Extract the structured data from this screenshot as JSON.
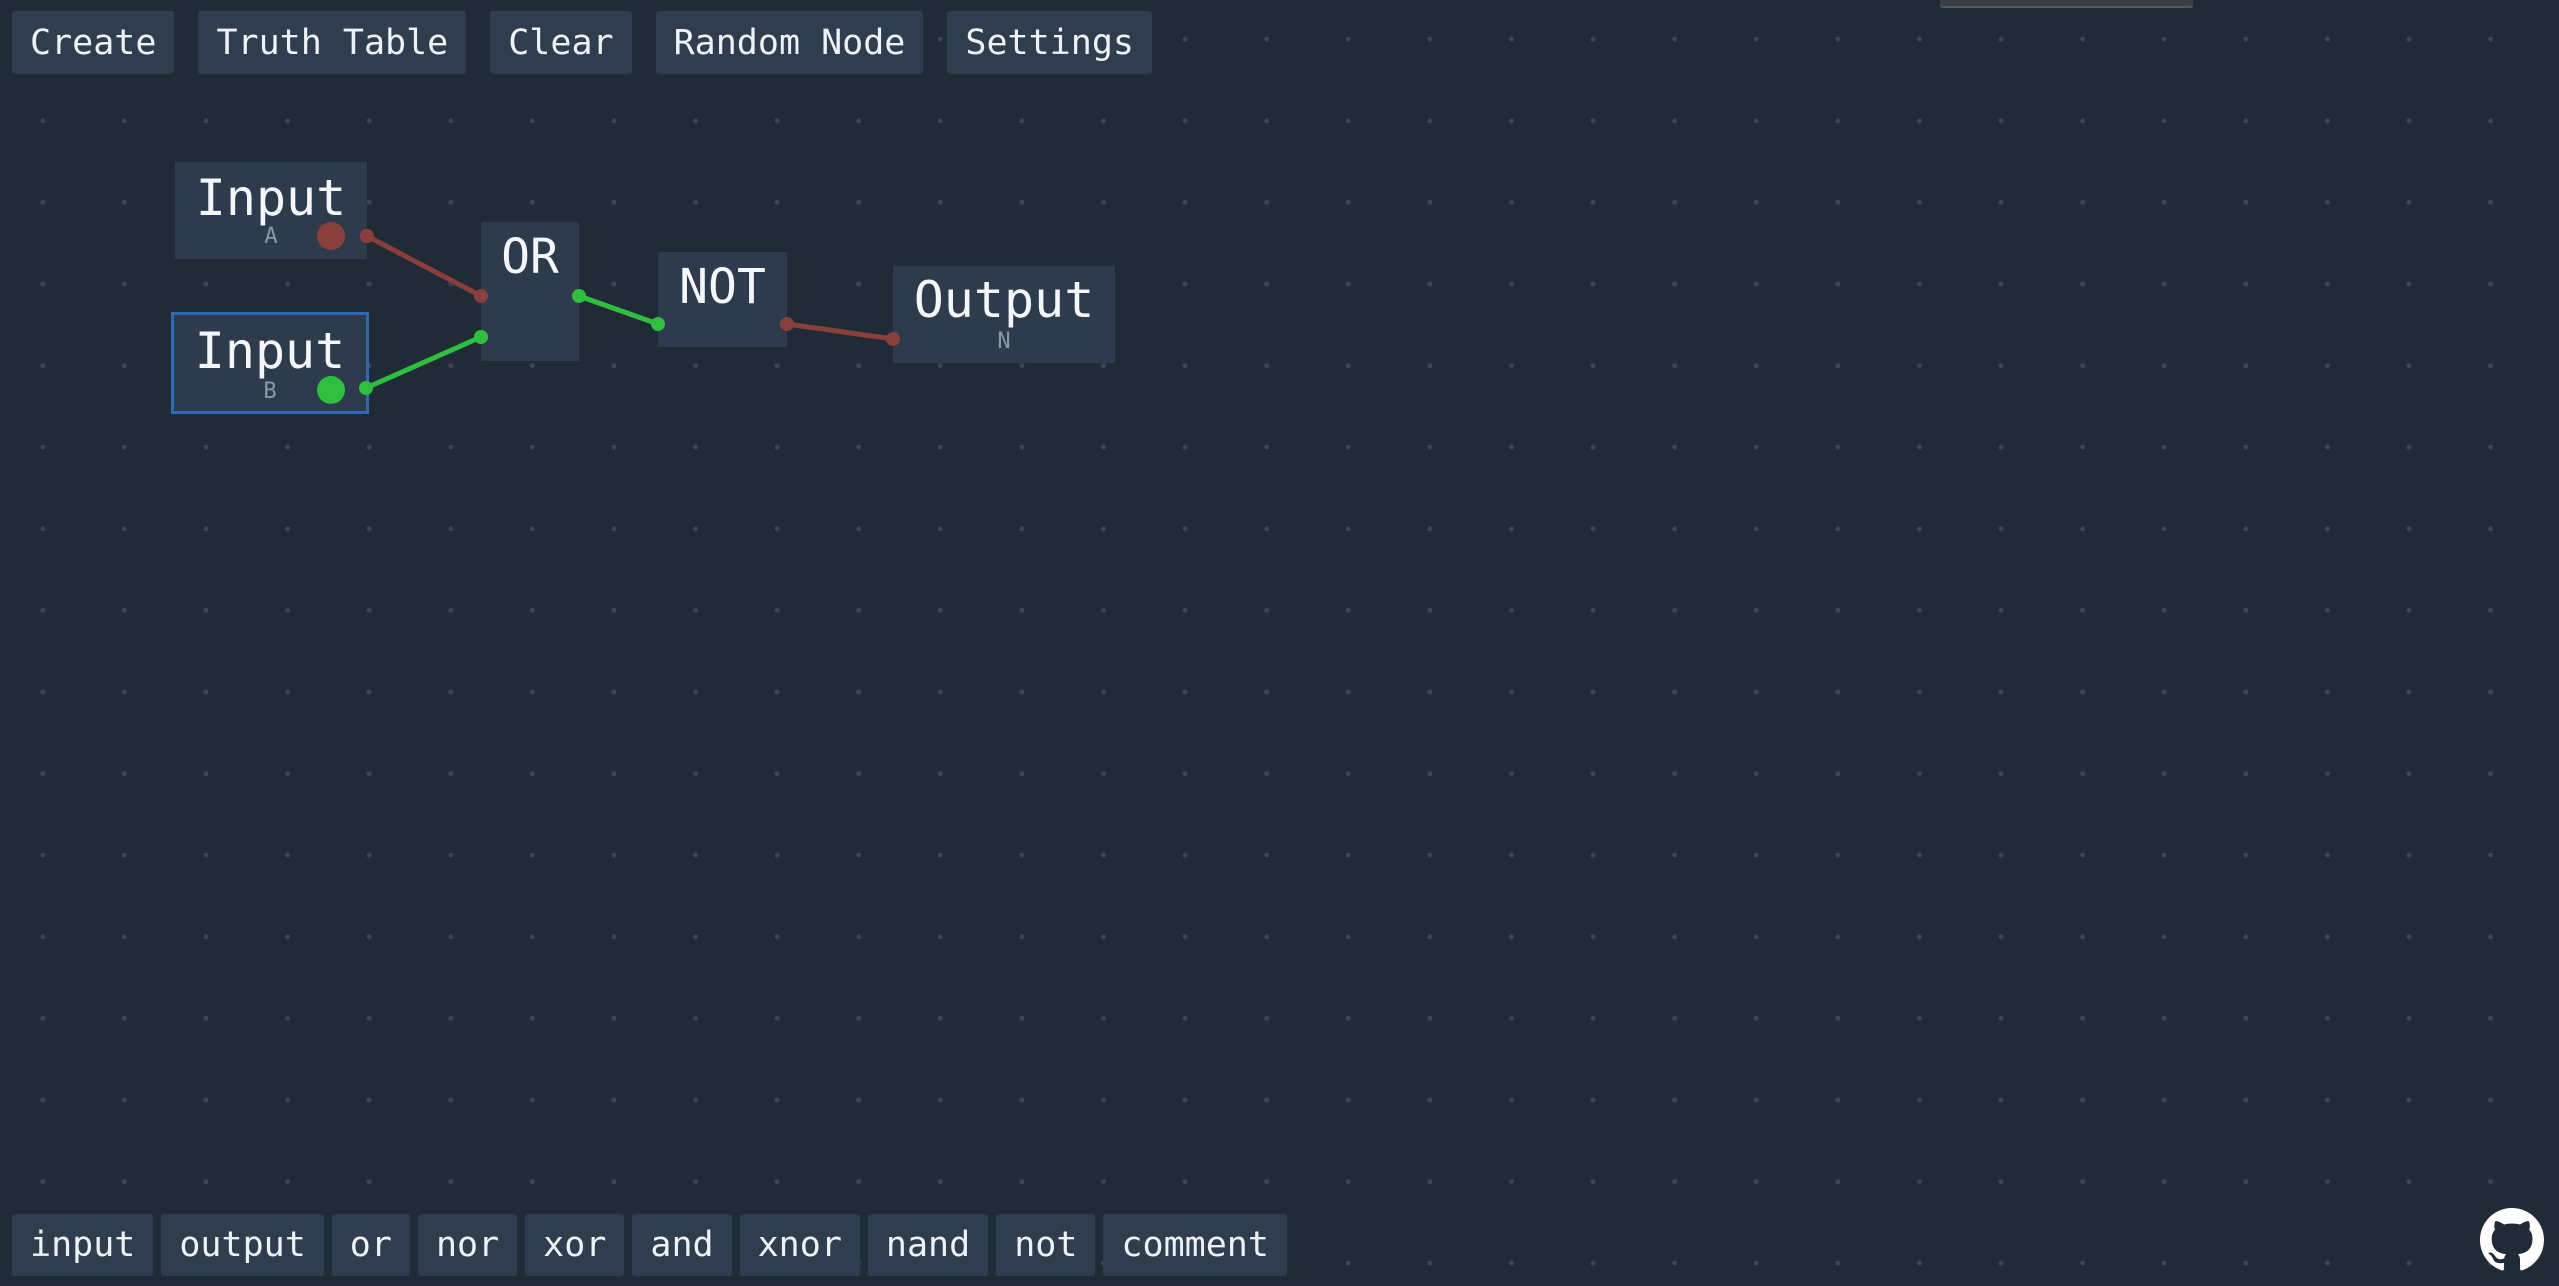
{
  "toolbar": {
    "create_label": "Create",
    "truth_table_label": "Truth Table",
    "clear_label": "Clear",
    "random_node_label": "Random Node",
    "settings_label": "Settings"
  },
  "nodes": {
    "input_a": {
      "title": "Input",
      "label": "A",
      "state": "off"
    },
    "input_b": {
      "title": "Input",
      "label": "B",
      "state": "on",
      "selected": true
    },
    "or_gate": {
      "title": "OR"
    },
    "not_gate": {
      "title": "NOT"
    },
    "output_n": {
      "title": "Output",
      "label": "N"
    }
  },
  "palette": {
    "input_label": "input",
    "output_label": "output",
    "or_label": "or",
    "nor_label": "nor",
    "xor_label": "xor",
    "and_label": "and",
    "xnor_label": "xnor",
    "nand_label": "nand",
    "not_label": "not",
    "comment_label": "comment"
  },
  "icons": {
    "github": "github-icon"
  },
  "colors": {
    "background": "#212b38",
    "node": "#2e3b4c",
    "button": "#2f3d4f",
    "signal_on": "#2fbf3f",
    "signal_off": "#8a3f3c",
    "selection": "#2f6bb3"
  }
}
